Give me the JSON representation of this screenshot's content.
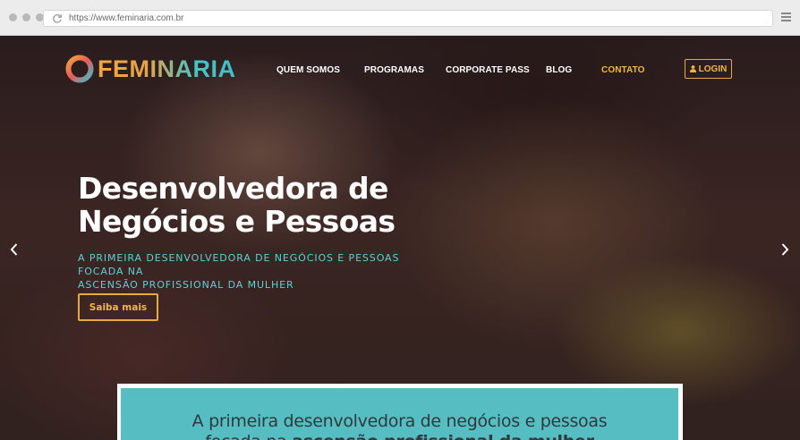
{
  "browser": {
    "url": "https://www.feminaria.com.br"
  },
  "header": {
    "logo_text": "FEMINARIA",
    "nav": [
      {
        "label": "QUEM SOMOS"
      },
      {
        "label": "PROGRAMAS"
      },
      {
        "label": "CORPORATE PASS"
      },
      {
        "label": "BLOG"
      },
      {
        "label": "CONTATO",
        "active": true
      }
    ],
    "login_label": "LOGIN"
  },
  "hero": {
    "headline_line1": "Desenvolvedora de",
    "headline_line2": "Negócios e Pessoas",
    "subtitle_line1": "A PRIMEIRA DESENVOLVEDORA DE NEGÓCIOS E PESSOAS FOCADA NA",
    "subtitle_line2": "ASCENSÃO PROFISSIONAL DA MULHER",
    "cta_label": "Saiba mais"
  },
  "intro": {
    "line1": "A primeira desenvolvedora de negócios e pessoas",
    "line2_prefix": "focada na ",
    "line2_bold": "ascensão profissional da mulher"
  },
  "colors": {
    "accent_gold": "#f2b544",
    "accent_teal": "#5ed0d6",
    "panel_teal": "#56bdc3"
  }
}
